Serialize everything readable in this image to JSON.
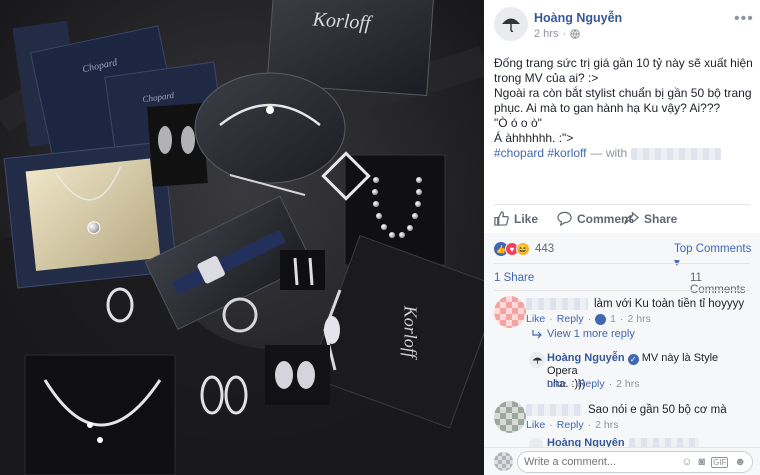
{
  "post": {
    "author": "Hoàng Nguyễn",
    "time": "2 hrs",
    "lines": [
      "Đống trang sức trị giá gần 10 tỷ này sẽ xuất hiện",
      "trong MV của ai? :>",
      "Ngoài ra còn bắt stylist chuẩn bị gần 50 bộ trang",
      "phục. Ai mà to gan hành hạ Ku vậy? Ai???",
      "\"Ò ó o ò\"",
      "Á àhhhhhh. :\">"
    ],
    "hashtags": "#chopard #korloff",
    "with_label": "— with"
  },
  "actions": {
    "like": "Like",
    "comment": "Comment",
    "share": "Share"
  },
  "stats": {
    "reactions_count": "443",
    "top_comments": "Top Comments ▾",
    "shares": "1 Share",
    "comments": "11 Comments"
  },
  "photo": {
    "brand_korloff": "Korloff",
    "brand_chopard": "Chopard",
    "brand_korloff_side": "Korloff"
  },
  "comments": [
    {
      "text": "làm với Ku toàn tiền tỉ hoyyyy",
      "like": "Like",
      "reply": "Reply",
      "like_count": "1",
      "time": "2 hrs",
      "view_replies": "View 1 more reply",
      "reply_item": {
        "author": "Hoàng Nguyễn",
        "text_line1": "MV này là Style Opera",
        "text_line2": "nha. :)))",
        "like": "Like",
        "reply": "Reply",
        "time": "2 hrs"
      }
    },
    {
      "text": "Sao nói e gần 50 bộ cơ mà",
      "like": "Like",
      "reply": "Reply",
      "time": "2 hrs"
    }
  ],
  "partial_comment": {
    "author": "Hoàng Nguyễn"
  },
  "composer": {
    "placeholder": "Write a comment..."
  },
  "colors": {
    "brand_blue": "#4267b2",
    "link_blue": "#365899",
    "verified": "#4267b2",
    "photo_bg": "#1e1e20"
  }
}
